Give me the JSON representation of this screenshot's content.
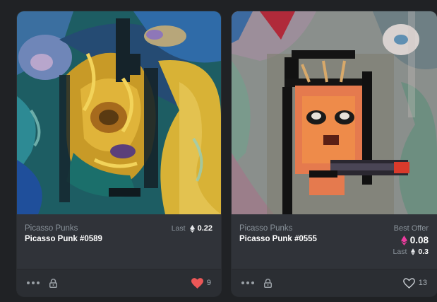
{
  "cards": [
    {
      "collection": "Picasso Punks",
      "title": "Picasso Punk #0589",
      "price_label": "Last",
      "price_value": "0.22",
      "likes": "9",
      "liked": true,
      "heart_color": "#eb5757"
    },
    {
      "collection": "Picasso Punks",
      "title": "Picasso Punk #0555",
      "price_label": "Best Offer",
      "price_value": "0.08",
      "last_label": "Last",
      "last_value": "0.3",
      "likes": "13",
      "liked": false,
      "weth_color": "#ec3c9e"
    }
  ],
  "icons": [
    "more-icon",
    "lock-icon",
    "eth-icon",
    "weth-icon",
    "heart-icon"
  ]
}
